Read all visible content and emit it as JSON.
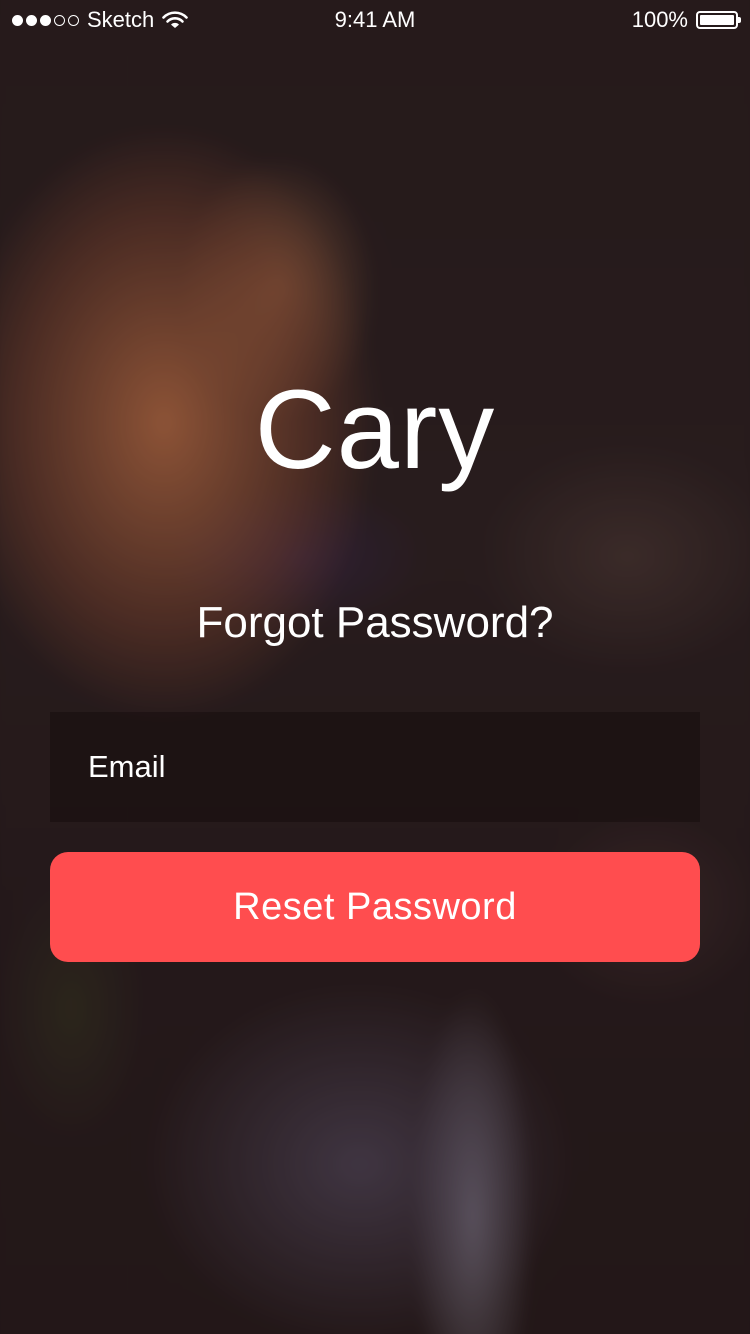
{
  "status_bar": {
    "carrier": "Sketch",
    "time": "9:41 AM",
    "battery_percent": "100%",
    "battery_level": 1.0,
    "signal_bars_filled": 3,
    "signal_bars_total": 5
  },
  "app": {
    "title": "Cary",
    "subtitle": "Forgot Password?"
  },
  "form": {
    "email_placeholder": "Email",
    "email_value": "",
    "reset_label": "Reset Password"
  },
  "colors": {
    "accent": "#ff4d4f",
    "text": "#ffffff",
    "field_background": "#1e1214"
  },
  "icons": {
    "signal": "signal-dots-icon",
    "wifi": "wifi-icon",
    "battery": "battery-icon"
  }
}
